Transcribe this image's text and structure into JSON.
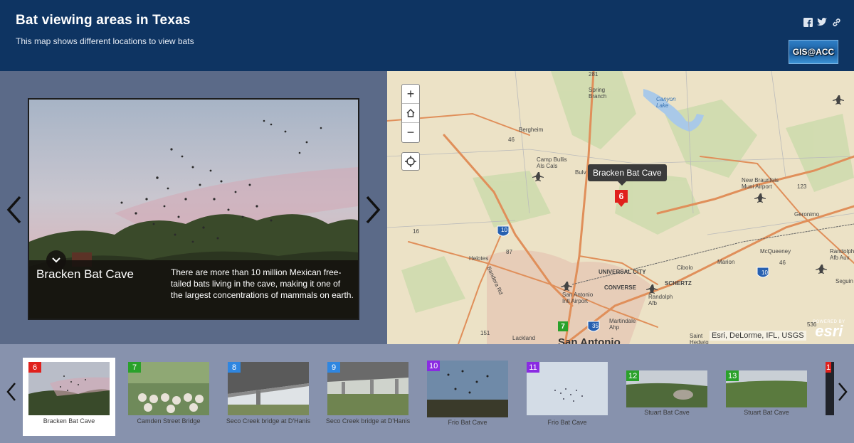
{
  "header": {
    "title": "Bat viewing areas in Texas",
    "subtitle": "This map shows different locations to view bats",
    "logo_text": "GIS@ACC",
    "share_icons": [
      "facebook-icon",
      "twitter-icon",
      "link-icon"
    ]
  },
  "media": {
    "caption_title": "Bracken Bat Cave",
    "caption_text": "There are more than 10 million Mexican free-tailed bats living in the cave, making it one of the largest concentrations of mammals on earth."
  },
  "map": {
    "tooltip": "Bracken Bat Cave",
    "selected_marker": "6",
    "visible_marker_2": "7",
    "zoom_in": "+",
    "zoom_out": "−",
    "attribution": "Esri, DeLorme, IFL, USGS",
    "esri_powered": "POWERED BY",
    "esri_name": "esri",
    "labels": {
      "spring_branch": "Spring Branch",
      "canyon_lake": "Canyon Lake",
      "bergheim": "Bergheim",
      "camp_bullis": "Camp Bullis Als Cals",
      "new_braunfels": "New Braunfels Muni Airport",
      "geronimo": "Geronimo",
      "helotes": "Helotes",
      "universal_city": "UNIVERSAL CITY",
      "converse": "CONVERSE",
      "schertz": "SCHERTZ",
      "cibolo": "Cibolo",
      "marion": "Marion",
      "mcqueeney": "McQueeney",
      "randolph": "Randolph Afb",
      "randolph2": "Randolph Afb Aux",
      "sa_airport": "San Antonio Intl Airport",
      "martindale": "Martindale Ahp",
      "lackland": "Lackland",
      "bandera": "Bandera Rd",
      "san_antonio": "San Antonio",
      "saint_hedwig": "Saint Hedwig",
      "seguin": "Seguin",
      "bulv": "Bulv",
      "r281": "281",
      "r46a": "46",
      "r46b": "46",
      "r16": "16",
      "r10a": "10",
      "r10b": "10",
      "r87": "87",
      "r35": "35",
      "r123": "123",
      "r151": "151",
      "r536": "536"
    }
  },
  "carousel": {
    "thumbs": [
      {
        "num": "6",
        "label": "Bracken Bat Cave",
        "color": "#e0201c"
      },
      {
        "num": "7",
        "label": "Camden Street Bridge",
        "color": "#2aa12a"
      },
      {
        "num": "8",
        "label": "Seco Creek bridge at D'Hanis",
        "color": "#2f86e0"
      },
      {
        "num": "9",
        "label": "Seco Creek bridge at D'Hanis",
        "color": "#2f86e0"
      },
      {
        "num": "10",
        "label": "Frio Bat Cave",
        "color": "#8a2be2"
      },
      {
        "num": "11",
        "label": "Frio Bat Cave",
        "color": "#8a2be2"
      },
      {
        "num": "12",
        "label": "Stuart Bat Cave",
        "color": "#2aa12a"
      },
      {
        "num": "13",
        "label": "Stuart Bat Cave",
        "color": "#2aa12a"
      },
      {
        "num": "1",
        "label": "",
        "color": "#e0201c"
      }
    ]
  }
}
